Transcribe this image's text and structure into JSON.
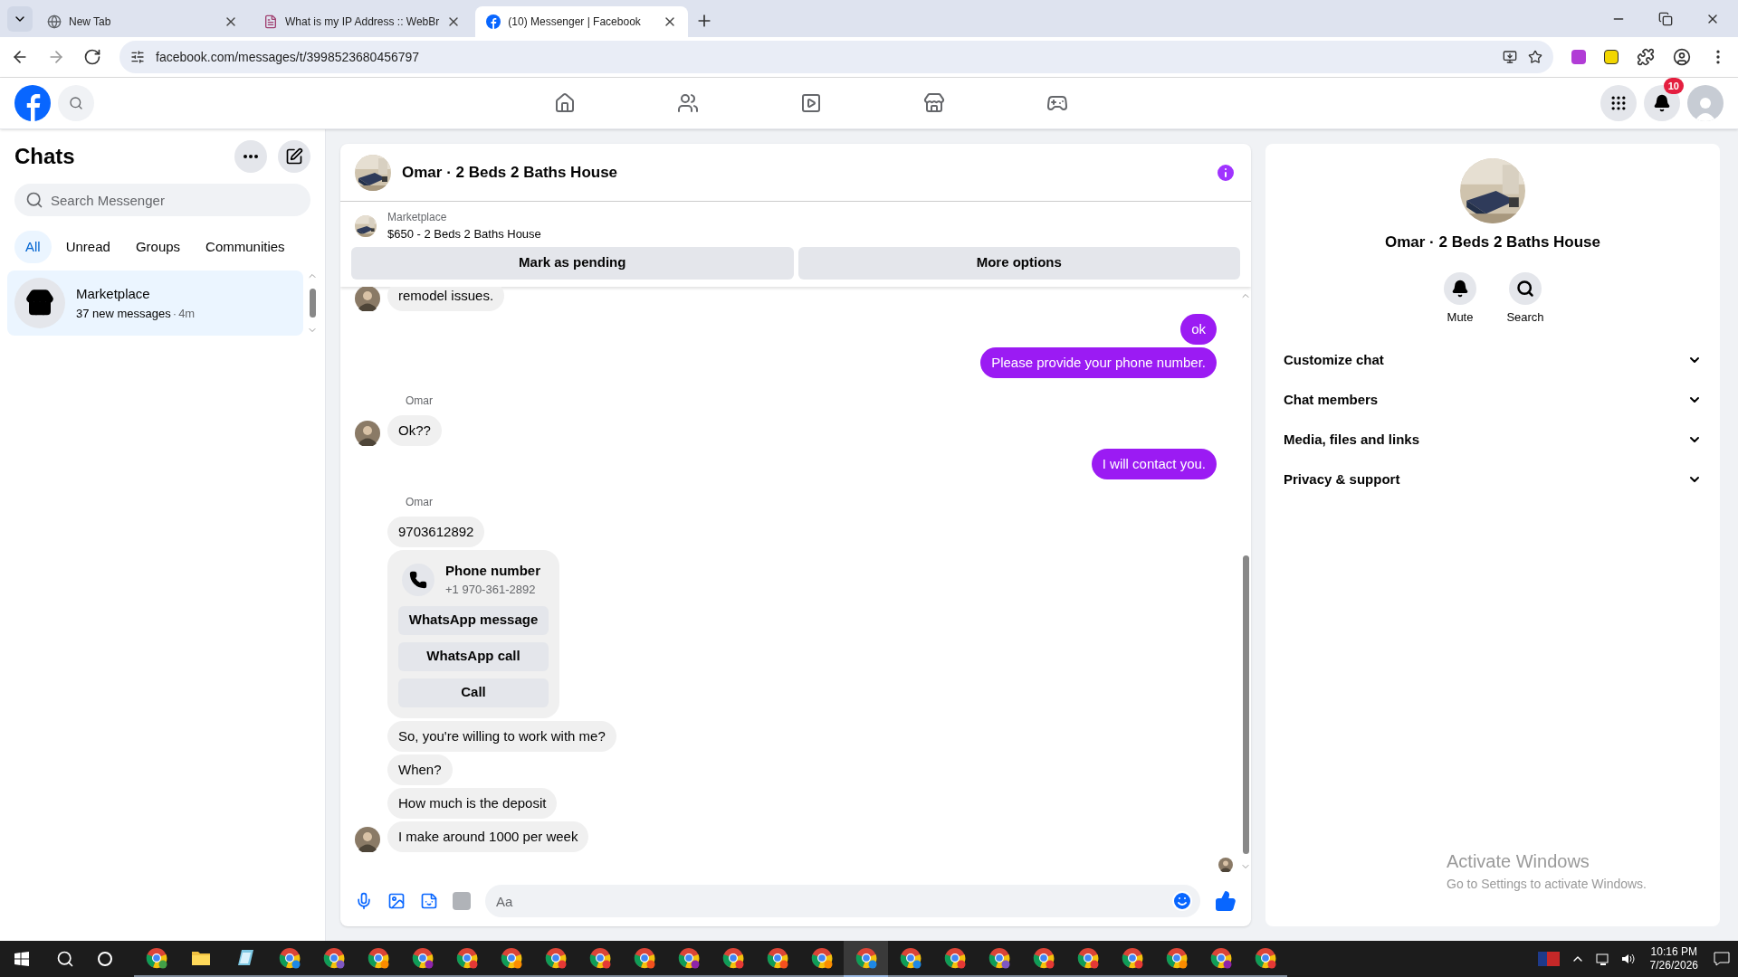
{
  "browser": {
    "tabs": [
      {
        "title": "New Tab",
        "kind": "chrome",
        "selected": false
      },
      {
        "title": "What is my IP Address :: WebBr",
        "kind": "site",
        "selected": false
      },
      {
        "title": "(10) Messenger | Facebook",
        "kind": "facebook",
        "selected": true
      }
    ],
    "address": "facebook.com/messages/t/3998523680456797"
  },
  "header": {
    "notification_count": "10"
  },
  "sidebar": {
    "title": "Chats",
    "search": {
      "placeholder": "Search Messenger"
    },
    "filters": [
      {
        "label": "All",
        "selected": true
      },
      {
        "label": "Unread",
        "selected": false
      },
      {
        "label": "Groups",
        "selected": false
      },
      {
        "label": "Communities",
        "selected": false
      }
    ],
    "chats": [
      {
        "name": "Marketplace",
        "preview": "37 new messages",
        "separator": "·",
        "time": "4m",
        "selected": true
      }
    ]
  },
  "conversation": {
    "title": "Omar · 2 Beds 2 Baths House",
    "listing": {
      "source": "Marketplace",
      "title": "$650 - 2 Beds 2 Baths House"
    },
    "actions": [
      "Mark as pending",
      "More options"
    ],
    "messages": [
      {
        "kind": "incoming",
        "text": "remodel issues.",
        "avatar": true
      },
      {
        "kind": "outgoing",
        "text": "ok"
      },
      {
        "kind": "outgoing",
        "text": "Please provide your phone number."
      },
      {
        "kind": "sender",
        "text": "Omar"
      },
      {
        "kind": "incoming",
        "text": "Ok??",
        "avatar": true
      },
      {
        "kind": "outgoing",
        "text": "I will contact you."
      },
      {
        "kind": "sender",
        "text": "Omar"
      },
      {
        "kind": "incoming",
        "text": "9703612892",
        "avatar": false
      },
      {
        "kind": "contact",
        "title": "Phone number",
        "number": "+1 970-361-2892",
        "buttons": [
          "WhatsApp message",
          "WhatsApp call",
          "Call"
        ]
      },
      {
        "kind": "incoming",
        "text": "So, you're willing to work with me?",
        "avatar": false
      },
      {
        "kind": "incoming",
        "text": "When?",
        "avatar": false
      },
      {
        "kind": "incoming",
        "text": "How much is the deposit",
        "avatar": false
      },
      {
        "kind": "incoming",
        "text": "I make around 1000 per week",
        "avatar": true
      }
    ],
    "composer": {
      "placeholder": "Aa"
    }
  },
  "details": {
    "title": "Omar · 2 Beds 2 Baths House",
    "actions": [
      {
        "kind": "mute",
        "label": "Mute"
      },
      {
        "kind": "search",
        "label": "Search"
      }
    ],
    "sections": [
      {
        "label": "Customize chat",
        "expanded": false
      },
      {
        "label": "Chat members",
        "expanded": false
      },
      {
        "label": "Media, files and links",
        "expanded": false
      },
      {
        "label": "Privacy & support",
        "expanded": false
      }
    ]
  },
  "activation_notice": {
    "title": "Activate Windows",
    "subtitle": "Go to Settings to activate Windows."
  },
  "taskbar": {
    "apps": [
      {
        "kind": "chrome",
        "color": "#43a047",
        "selected": false
      },
      {
        "kind": "folder",
        "selected": false
      },
      {
        "kind": "notepad",
        "selected": false
      },
      {
        "kind": "chrome",
        "color": "#1e88e5",
        "selected": false
      },
      {
        "kind": "chrome",
        "color": "#7e57c2",
        "selected": false
      },
      {
        "kind": "chrome",
        "color": "#fb8c00",
        "selected": false
      },
      {
        "kind": "chrome",
        "color": "#8e24aa",
        "selected": false
      },
      {
        "kind": "chrome",
        "color": "#e53935",
        "selected": false
      },
      {
        "kind": "chrome",
        "color": "#fb8c00",
        "selected": false
      },
      {
        "kind": "chrome",
        "color": "#e53935",
        "selected": false
      },
      {
        "kind": "chrome",
        "color": "#e53935",
        "selected": false
      },
      {
        "kind": "chrome",
        "color": "#f4511e",
        "selected": false
      },
      {
        "kind": "chrome",
        "color": "#8e24aa",
        "selected": false
      },
      {
        "kind": "chrome",
        "color": "#e53935",
        "selected": false
      },
      {
        "kind": "chrome",
        "color": "#f4511e",
        "selected": false
      },
      {
        "kind": "chrome",
        "color": "#fb8c00",
        "selected": false
      },
      {
        "kind": "chrome",
        "color": "#1e88e5",
        "selected": true
      },
      {
        "kind": "chrome",
        "color": "#1e88e5",
        "selected": false
      },
      {
        "kind": "chrome",
        "color": "#e53935",
        "selected": false
      },
      {
        "kind": "chrome",
        "color": "#7e57c2",
        "selected": false
      },
      {
        "kind": "chrome",
        "color": "#e53935",
        "selected": false
      },
      {
        "kind": "chrome",
        "color": "#e53935",
        "selected": false
      },
      {
        "kind": "chrome",
        "color": "#e53935",
        "selected": false
      },
      {
        "kind": "chrome",
        "color": "#fb8c00",
        "selected": false
      },
      {
        "kind": "chrome",
        "color": "#8e24aa",
        "selected": false
      },
      {
        "kind": "chrome",
        "color": "#e53935",
        "selected": false
      }
    ],
    "time": "10:16 PM",
    "date": "7/26/2026"
  }
}
